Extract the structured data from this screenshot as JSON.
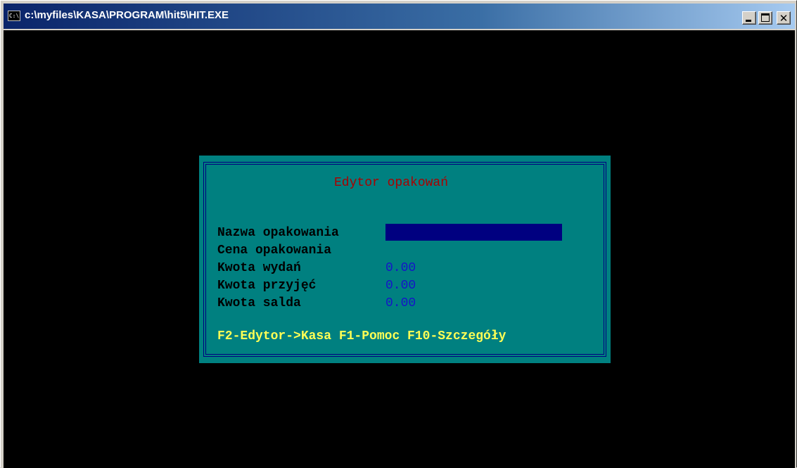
{
  "window": {
    "title": "c:\\myfiles\\KASA\\PROGRAM\\hit5\\HIT.EXE",
    "icon_text": "C:\\"
  },
  "dialog": {
    "title": "Edytor opakowań",
    "fields": [
      {
        "label": "Nazwa opakowania",
        "value": ""
      },
      {
        "label": "Cena opakowania",
        "value": ""
      },
      {
        "label": "Kwota wydań",
        "value": "0.00"
      },
      {
        "label": "Kwota przyjęć",
        "value": "0.00"
      },
      {
        "label": "Kwota salda",
        "value": "0.00"
      }
    ],
    "hotkeys": "F2-Edytor->Kasa F1-Pomoc F10-Szczegóły"
  },
  "colors": {
    "console_bg": "#000000",
    "dialog_bg": "#008080",
    "frame": "#000080",
    "title_text": "#aa0000",
    "value_text": "#1515c8",
    "hotkey_text": "#ffff55"
  }
}
